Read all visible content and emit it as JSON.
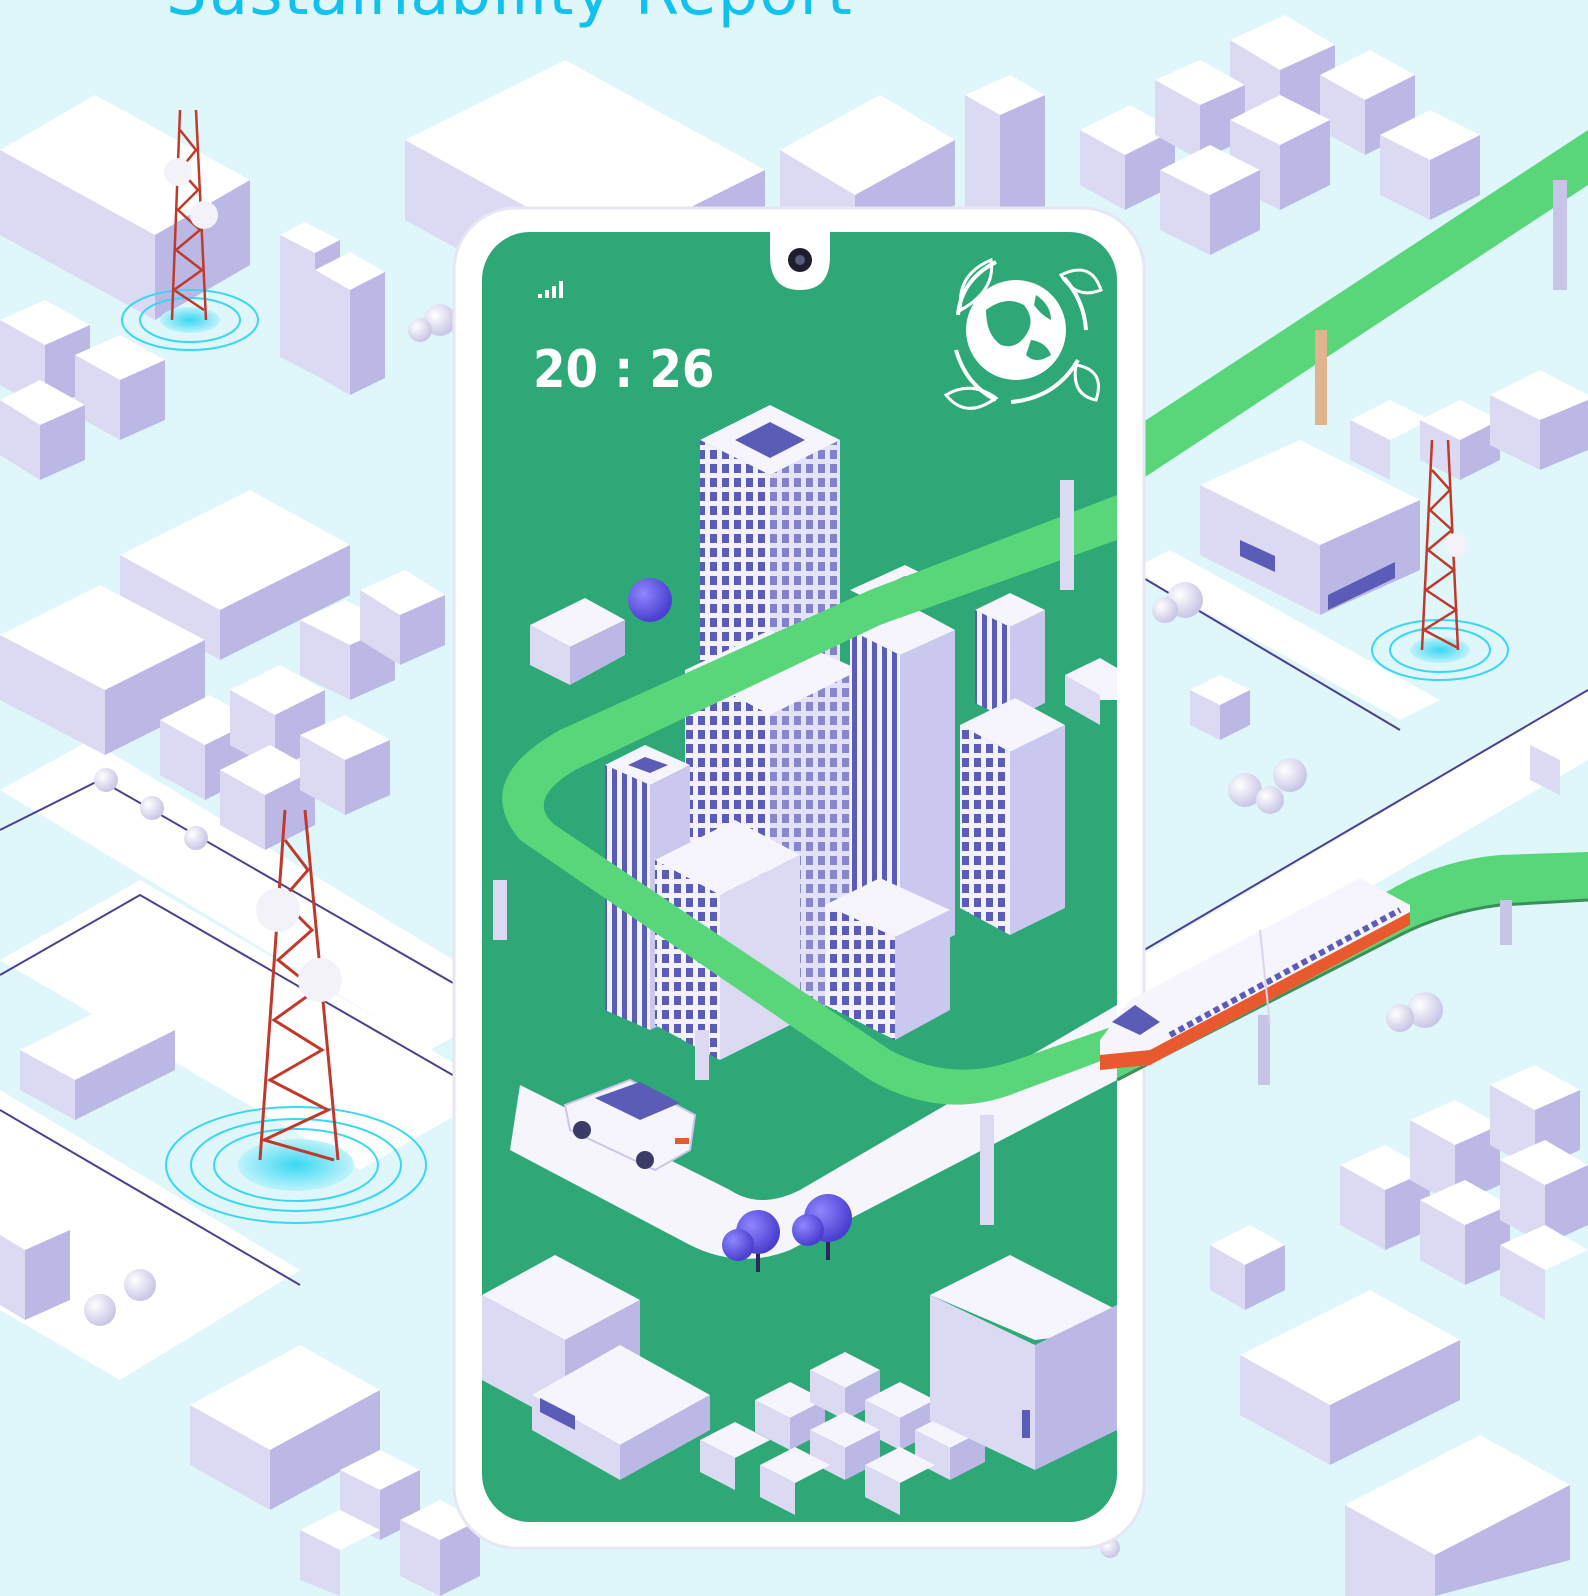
{
  "cover": {
    "title": "Sustainability Report"
  },
  "phone": {
    "time": "20 : 26",
    "signal_icon": "signal-bars-icon",
    "badge_icon": "eco-globe-leaves-icon"
  },
  "colors": {
    "title": "#12c2ec",
    "background": "#dff6fb",
    "screen_green": "#2ea877",
    "road_green": "#5ad67a",
    "building": "#f6f4fd",
    "building_shade": "#cbc8ef",
    "window": "#5b5bb8",
    "tower_red": "#c0392b",
    "tower_glow": "#39d7f3",
    "train_orange": "#e85a2e"
  },
  "illustration": {
    "elements": [
      "city-blocks",
      "telecom-towers",
      "smartphone",
      "skyscrapers",
      "elevated-green-road",
      "train",
      "car",
      "trees"
    ]
  }
}
